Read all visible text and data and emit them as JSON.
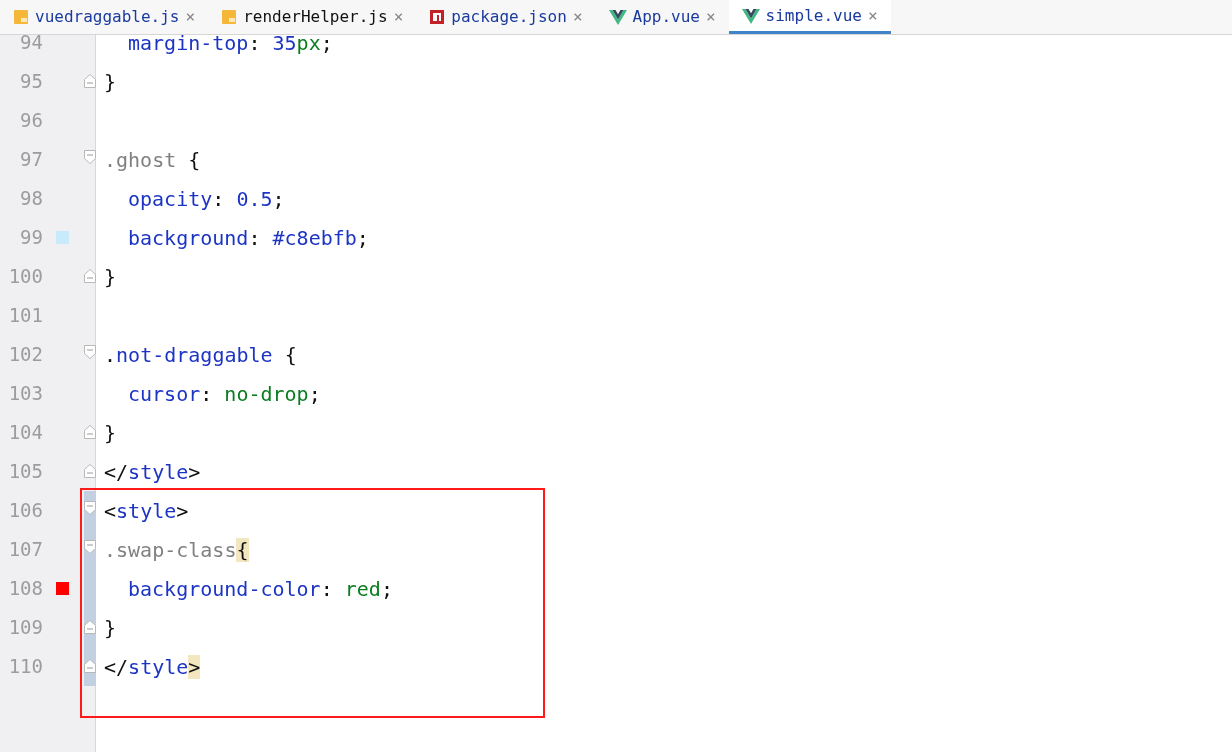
{
  "tabs": [
    {
      "kind": "js",
      "label": "vuedraggable.js",
      "modified": true,
      "selected": false,
      "close": "×"
    },
    {
      "kind": "js",
      "label": "renderHelper.js",
      "modified": false,
      "selected": false,
      "close": "×"
    },
    {
      "kind": "json",
      "label": "package.json",
      "modified": true,
      "selected": false,
      "close": "×"
    },
    {
      "kind": "vue",
      "label": "App.vue",
      "modified": true,
      "selected": false,
      "close": "×"
    },
    {
      "kind": "vue",
      "label": "simple.vue",
      "modified": true,
      "selected": true,
      "close": "×"
    }
  ],
  "lines": [
    {
      "number": "94",
      "indent": true,
      "tokens": [
        {
          "kind": "property",
          "text": "margin-top"
        },
        {
          "kind": "punct",
          "text": ": "
        },
        {
          "kind": "number",
          "text": "35"
        },
        {
          "kind": "unit",
          "text": "px"
        },
        {
          "kind": "punct",
          "text": ";"
        }
      ]
    },
    {
      "number": "95",
      "fold_end": true,
      "tokens": [
        {
          "kind": "punct",
          "text": "}"
        }
      ]
    },
    {
      "number": "96"
    },
    {
      "number": "97",
      "fold_start": true,
      "tokens": [
        {
          "kind": "selector",
          "text": ".ghost"
        },
        {
          "kind": "punct",
          "text": " {"
        }
      ]
    },
    {
      "number": "98",
      "indent": true,
      "tokens": [
        {
          "kind": "property",
          "text": "opacity"
        },
        {
          "kind": "punct",
          "text": ": "
        },
        {
          "kind": "number",
          "text": "0.5"
        },
        {
          "kind": "punct",
          "text": ";"
        }
      ]
    },
    {
      "number": "99",
      "indent": true,
      "color": "#c8ebfb",
      "tokens": [
        {
          "kind": "property",
          "text": "background"
        },
        {
          "kind": "punct",
          "text": ": "
        },
        {
          "kind": "number",
          "text": "#c8ebfb"
        },
        {
          "kind": "punct",
          "text": ";"
        }
      ]
    },
    {
      "number": "100",
      "fold_end": true,
      "tokens": [
        {
          "kind": "punct",
          "text": "}"
        }
      ]
    },
    {
      "number": "101"
    },
    {
      "number": "102",
      "fold_start": true,
      "tokens": [
        {
          "kind": "punct",
          "text": "."
        },
        {
          "kind": "class",
          "text": "not-draggable"
        },
        {
          "kind": "punct",
          "text": " {"
        }
      ]
    },
    {
      "number": "103",
      "indent": true,
      "tokens": [
        {
          "kind": "property",
          "text": "cursor"
        },
        {
          "kind": "punct",
          "text": ": "
        },
        {
          "kind": "value",
          "text": "no-drop"
        },
        {
          "kind": "punct",
          "text": ";"
        }
      ]
    },
    {
      "number": "104",
      "fold_end": true,
      "tokens": [
        {
          "kind": "punct",
          "text": "}"
        }
      ]
    },
    {
      "number": "105",
      "fold_end": true,
      "tokens": [
        {
          "kind": "punct",
          "text": "</"
        },
        {
          "kind": "tag",
          "text": "style"
        },
        {
          "kind": "punct",
          "text": ">"
        }
      ]
    },
    {
      "number": "106",
      "fold_start": true,
      "changed": true,
      "boxed": true,
      "tokens": [
        {
          "kind": "punct",
          "text": "<"
        },
        {
          "kind": "tag",
          "text": "style"
        },
        {
          "kind": "punct",
          "text": ">"
        }
      ]
    },
    {
      "number": "107",
      "fold_start": true,
      "changed": true,
      "boxed": true,
      "tokens": [
        {
          "kind": "selector",
          "text": ".swap-class"
        },
        {
          "kind": "match",
          "text": "{"
        }
      ]
    },
    {
      "number": "108",
      "indent": true,
      "changed": true,
      "boxed": true,
      "color": "#ff0000",
      "tokens": [
        {
          "kind": "property",
          "text": "background-color"
        },
        {
          "kind": "punct",
          "text": ": "
        },
        {
          "kind": "value",
          "text": "red"
        },
        {
          "kind": "punct",
          "text": ";"
        }
      ]
    },
    {
      "number": "109",
      "fold_end": true,
      "changed": true,
      "boxed": true,
      "tokens": [
        {
          "kind": "punct",
          "text": "}"
        }
      ]
    },
    {
      "number": "110",
      "fold_end": true,
      "changed": true,
      "boxed": true,
      "tokens": [
        {
          "kind": "punct",
          "text": "</"
        },
        {
          "kind": "tag",
          "text": "style"
        },
        {
          "kind": "match",
          "text": ">"
        }
      ]
    }
  ]
}
